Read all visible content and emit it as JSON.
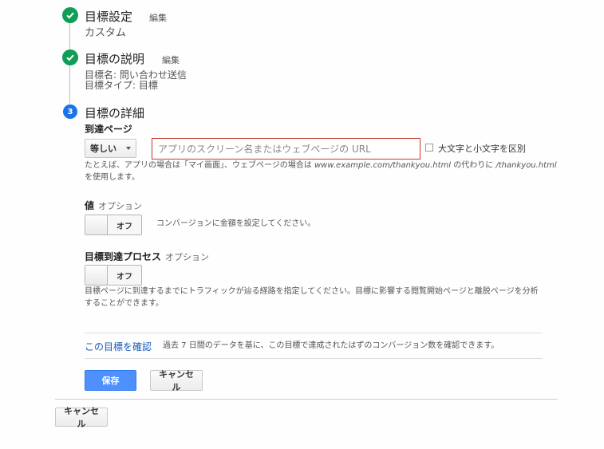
{
  "steps": [
    {
      "icon": "check-icon",
      "title": "目標設定",
      "edit_label": "編集",
      "details": [
        "カスタム"
      ]
    },
    {
      "icon": "check-icon",
      "title": "目標の説明",
      "edit_label": "編集",
      "details": [
        "目標名: 問い合わせ送信",
        "目標タイプ: 目標"
      ]
    },
    {
      "number": "3",
      "title": "目標の詳細"
    }
  ],
  "destination": {
    "label": "到達ページ",
    "match_type": "等しい",
    "url_placeholder": "アプリのスクリーン名またはウェブページの URL",
    "url_value": "",
    "case_sensitive_label": "大文字と小文字を区別",
    "case_sensitive_checked": false,
    "help_parts": [
      "たとえば、アプリの場合は「マイ画面」、ウェブページの場合は ",
      "www.example.com/thankyou.html",
      " の代わりに ",
      "/thankyou.html"
    ],
    "help_line2": "を使用します。"
  },
  "value": {
    "label": "値",
    "optional": "オプション",
    "toggle_state": "オフ",
    "description": "コンバージョンに金額を設定してください。"
  },
  "funnel": {
    "label": "目標到達プロセス",
    "optional": "オプション",
    "toggle_state": "オフ",
    "description_line1": "目標ページに到達するまでにトラフィックが辿る経路を指定してください。目標に影響する閲覧開始ページと離脱ページを分析",
    "description_line2": "することができます。"
  },
  "verify": {
    "link": "この目標を確認",
    "description": "過去 7 日間のデータを基に、この目標で達成されたはずのコンバージョン数を確認できます。"
  },
  "actions": {
    "save": "保存",
    "cancel": "キャンセル",
    "outer_cancel": "キャンセル"
  },
  "colors": {
    "step_done": "#0f9d58",
    "step_active": "#1a73e8",
    "primary_button": "#4d90fe",
    "link": "#1a5ab8",
    "input_error_border": "#c0392b"
  }
}
